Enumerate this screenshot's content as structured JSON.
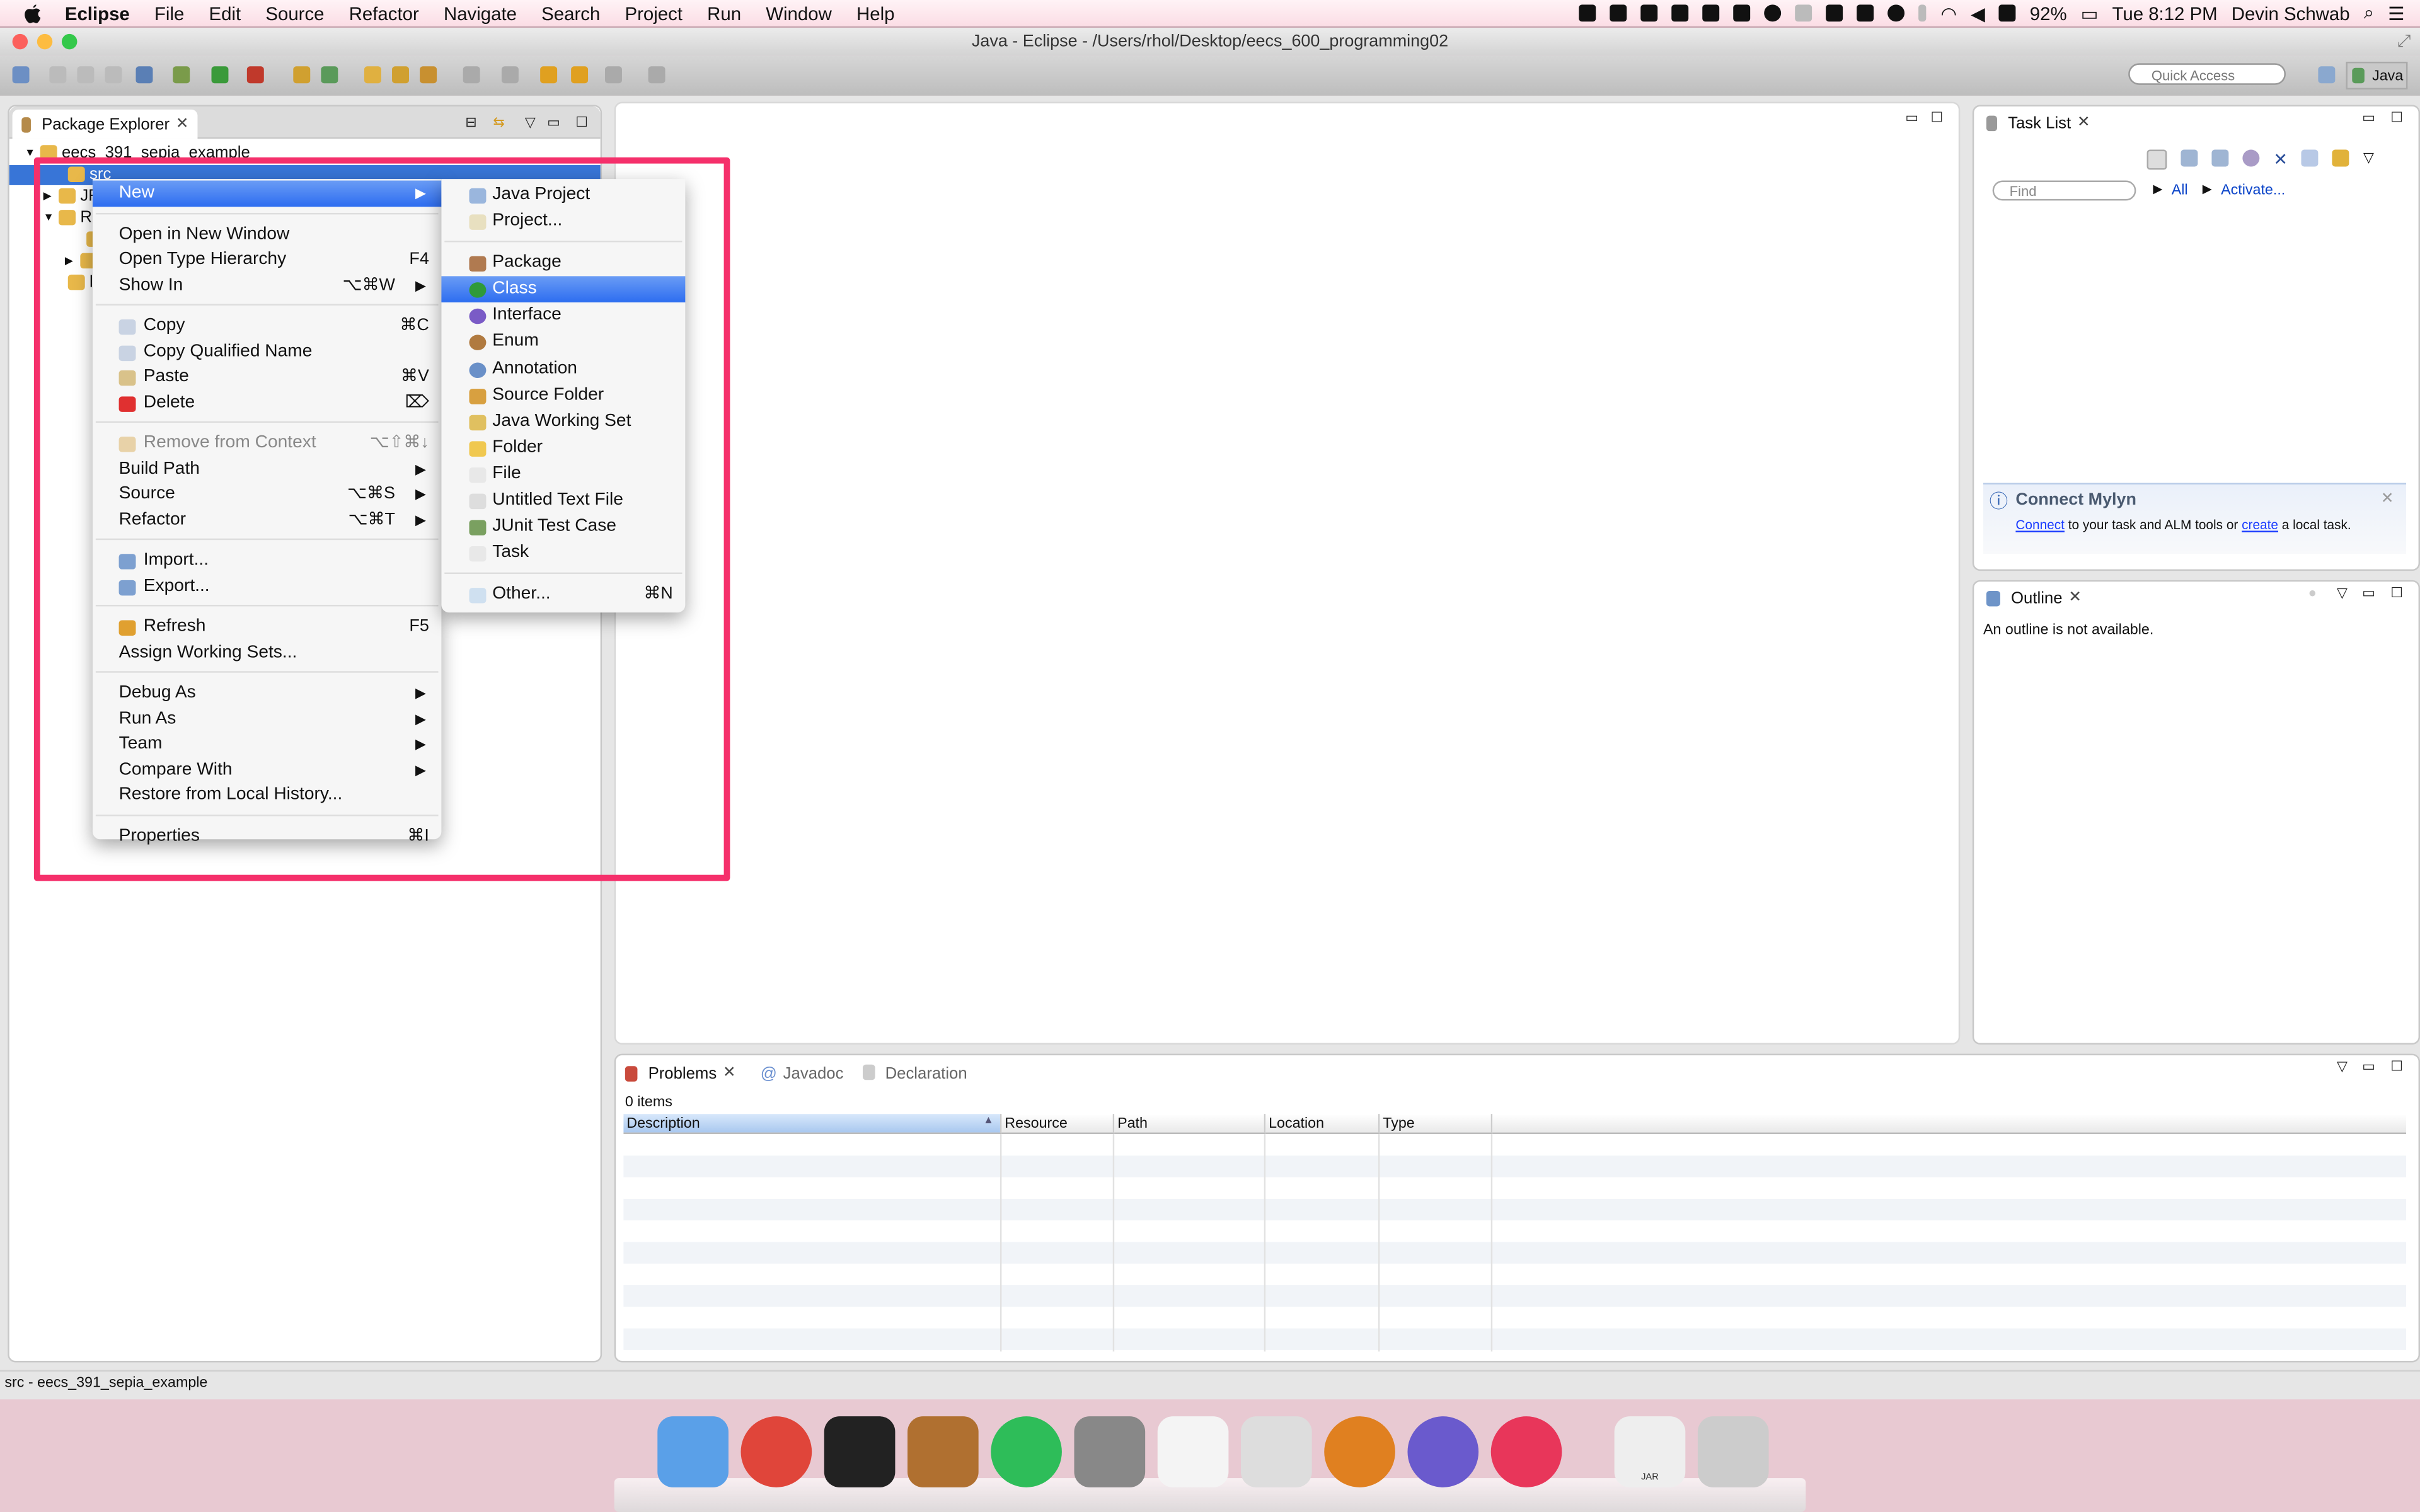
{
  "menubar": {
    "app": "Eclipse",
    "items": [
      "File",
      "Edit",
      "Source",
      "Refactor",
      "Navigate",
      "Search",
      "Project",
      "Run",
      "Window",
      "Help"
    ],
    "status": {
      "battery": "92%",
      "clock": "Tue 8:12 PM",
      "user": "Devin Schwab"
    }
  },
  "window": {
    "title": "Java - Eclipse - /Users/rhol/Desktop/eecs_600_programming02"
  },
  "toolbar": {
    "quick_access_placeholder": "Quick Access",
    "perspective": "Java"
  },
  "package_explorer": {
    "tab": "Package Explorer",
    "tree": [
      {
        "label": "eecs_391_sepia_example",
        "expanded": true
      },
      {
        "label": "src",
        "selected": true
      },
      {
        "label": "JR"
      },
      {
        "label": "R",
        "expanded": true
      },
      {
        "label": ""
      },
      {
        "label": ""
      },
      {
        "label": "li"
      }
    ]
  },
  "context_menu": {
    "groups": [
      [
        {
          "label": "New",
          "submenu": true,
          "highlighted": true
        }
      ],
      [
        {
          "label": "Open in New Window"
        },
        {
          "label": "Open Type Hierarchy",
          "shortcut": "F4"
        },
        {
          "label": "Show In",
          "shortcut": "⌥⌘W",
          "submenu": true
        }
      ],
      [
        {
          "label": "Copy",
          "shortcut": "⌘C",
          "icon": "copy-icon"
        },
        {
          "label": "Copy Qualified Name",
          "icon": "copy-qualified-icon"
        },
        {
          "label": "Paste",
          "shortcut": "⌘V",
          "icon": "paste-icon"
        },
        {
          "label": "Delete",
          "shortcut": "⌦",
          "icon": "delete-icon"
        }
      ],
      [
        {
          "label": "Remove from Context",
          "shortcut": "⌥⇧⌘↓",
          "disabled": true,
          "icon": "remove-context-icon"
        },
        {
          "label": "Build Path",
          "submenu": true
        },
        {
          "label": "Source",
          "shortcut": "⌥⌘S",
          "submenu": true
        },
        {
          "label": "Refactor",
          "shortcut": "⌥⌘T",
          "submenu": true
        }
      ],
      [
        {
          "label": "Import...",
          "icon": "import-icon"
        },
        {
          "label": "Export...",
          "icon": "export-icon"
        }
      ],
      [
        {
          "label": "Refresh",
          "shortcut": "F5",
          "icon": "refresh-icon"
        },
        {
          "label": "Assign Working Sets..."
        }
      ],
      [
        {
          "label": "Debug As",
          "submenu": true
        },
        {
          "label": "Run As",
          "submenu": true
        },
        {
          "label": "Team",
          "submenu": true
        },
        {
          "label": "Compare With",
          "submenu": true
        },
        {
          "label": "Restore from Local History..."
        }
      ],
      [
        {
          "label": "Properties",
          "shortcut": "⌘I"
        }
      ]
    ]
  },
  "new_submenu": {
    "groups": [
      [
        {
          "label": "Java Project",
          "icon": "java-project-icon"
        },
        {
          "label": "Project...",
          "icon": "project-icon"
        }
      ],
      [
        {
          "label": "Package",
          "icon": "package-icon"
        },
        {
          "label": "Class",
          "icon": "class-icon",
          "highlighted": true
        },
        {
          "label": "Interface",
          "icon": "interface-icon"
        },
        {
          "label": "Enum",
          "icon": "enum-icon"
        },
        {
          "label": "Annotation",
          "icon": "annotation-icon"
        },
        {
          "label": "Source Folder",
          "icon": "source-folder-icon"
        },
        {
          "label": "Java Working Set",
          "icon": "working-set-icon"
        },
        {
          "label": "Folder",
          "icon": "folder-icon"
        },
        {
          "label": "File",
          "icon": "file-icon"
        },
        {
          "label": "Untitled Text File",
          "icon": "text-file-icon"
        },
        {
          "label": "JUnit Test Case",
          "icon": "junit-icon"
        },
        {
          "label": "Task",
          "icon": "task-icon"
        }
      ],
      [
        {
          "label": "Other...",
          "shortcut": "⌘N",
          "icon": "other-icon"
        }
      ]
    ]
  },
  "task_list": {
    "tab": "Task List",
    "find_placeholder": "Find",
    "all": "All",
    "activate": "Activate...",
    "mylyn": {
      "title": "Connect Mylyn",
      "connect": "Connect",
      "text1": " to your task and ALM tools or ",
      "create": "create",
      "text2": " a local task."
    }
  },
  "outline": {
    "tab": "Outline",
    "message": "An outline is not available."
  },
  "problems": {
    "tabs": [
      "Problems",
      "Javadoc",
      "Declaration"
    ],
    "count": "0 items",
    "columns": [
      "Description",
      "Resource",
      "Path",
      "Location",
      "Type"
    ]
  },
  "statusbar": {
    "text": "src - eecs_391_sepia_example"
  },
  "dock": {
    "apps": [
      "Finder",
      "Chrome",
      "Terminal",
      "GIMP",
      "Spotify",
      "System Preferences",
      "Launchpad",
      "X11",
      "Firefox",
      "Eclipse",
      "Airmail",
      "JAR",
      "Trash"
    ],
    "jar_label": "JAR"
  },
  "colors": {
    "highlight_box": "#f5306b",
    "selection": "#3875d7",
    "menu_highlight": "#2d6df0",
    "link": "#0b44c9"
  }
}
